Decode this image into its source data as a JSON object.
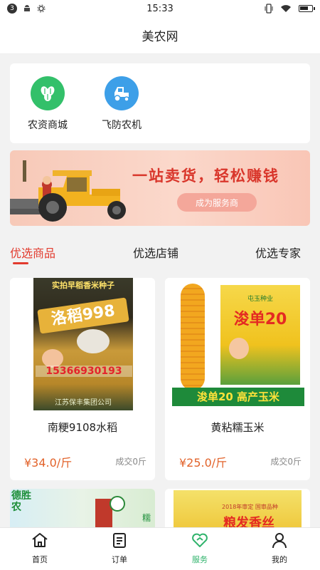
{
  "status_bar": {
    "notification_count": "3",
    "time": "15:33",
    "battery_level": 0.7
  },
  "header": {
    "title": "美农网"
  },
  "entries": [
    {
      "label": "农资商城",
      "icon": "seed-icon",
      "color": "#33c06a"
    },
    {
      "label": "飞防农机",
      "icon": "tractor-icon",
      "color": "#3d9fe8"
    }
  ],
  "banner": {
    "slogan": "一站卖货，轻松赚钱",
    "button": "成为服务商"
  },
  "tabs": [
    {
      "label": "优选商品",
      "active": true
    },
    {
      "label": "优选店铺",
      "active": false
    },
    {
      "label": "优选专家",
      "active": false
    }
  ],
  "products": [
    {
      "name": "南粳9108水稻",
      "price": "¥34.0/斤",
      "sold": "成交0斤",
      "image_text": {
        "banner": "实拍早稻香米种子",
        "brand": "洛稻998",
        "phone": "15366930193",
        "footer": "江苏保丰集团公司"
      }
    },
    {
      "name": "黄粘糯玉米",
      "price": "¥25.0/斤",
      "sold": "成交0斤",
      "image_text": {
        "brand": "浚单20",
        "caption": "浚单20 高产玉米",
        "top": "屯玉种业"
      }
    },
    {
      "name": "",
      "image_text": {
        "side": "德胜农",
        "tag": "糯"
      }
    },
    {
      "name": "",
      "image_text": {
        "top": "2018年审定 国审品种",
        "brand": "粮发香丝"
      }
    }
  ],
  "nav": [
    {
      "label": "首页",
      "icon": "home-icon",
      "active": false
    },
    {
      "label": "订单",
      "icon": "order-icon",
      "active": false
    },
    {
      "label": "服务",
      "icon": "service-heart-icon",
      "active": true
    },
    {
      "label": "我的",
      "icon": "profile-icon",
      "active": false
    }
  ],
  "colors": {
    "accent_red": "#e23b2e",
    "price_orange": "#e2632b",
    "nav_active_green": "#2fb36b"
  }
}
